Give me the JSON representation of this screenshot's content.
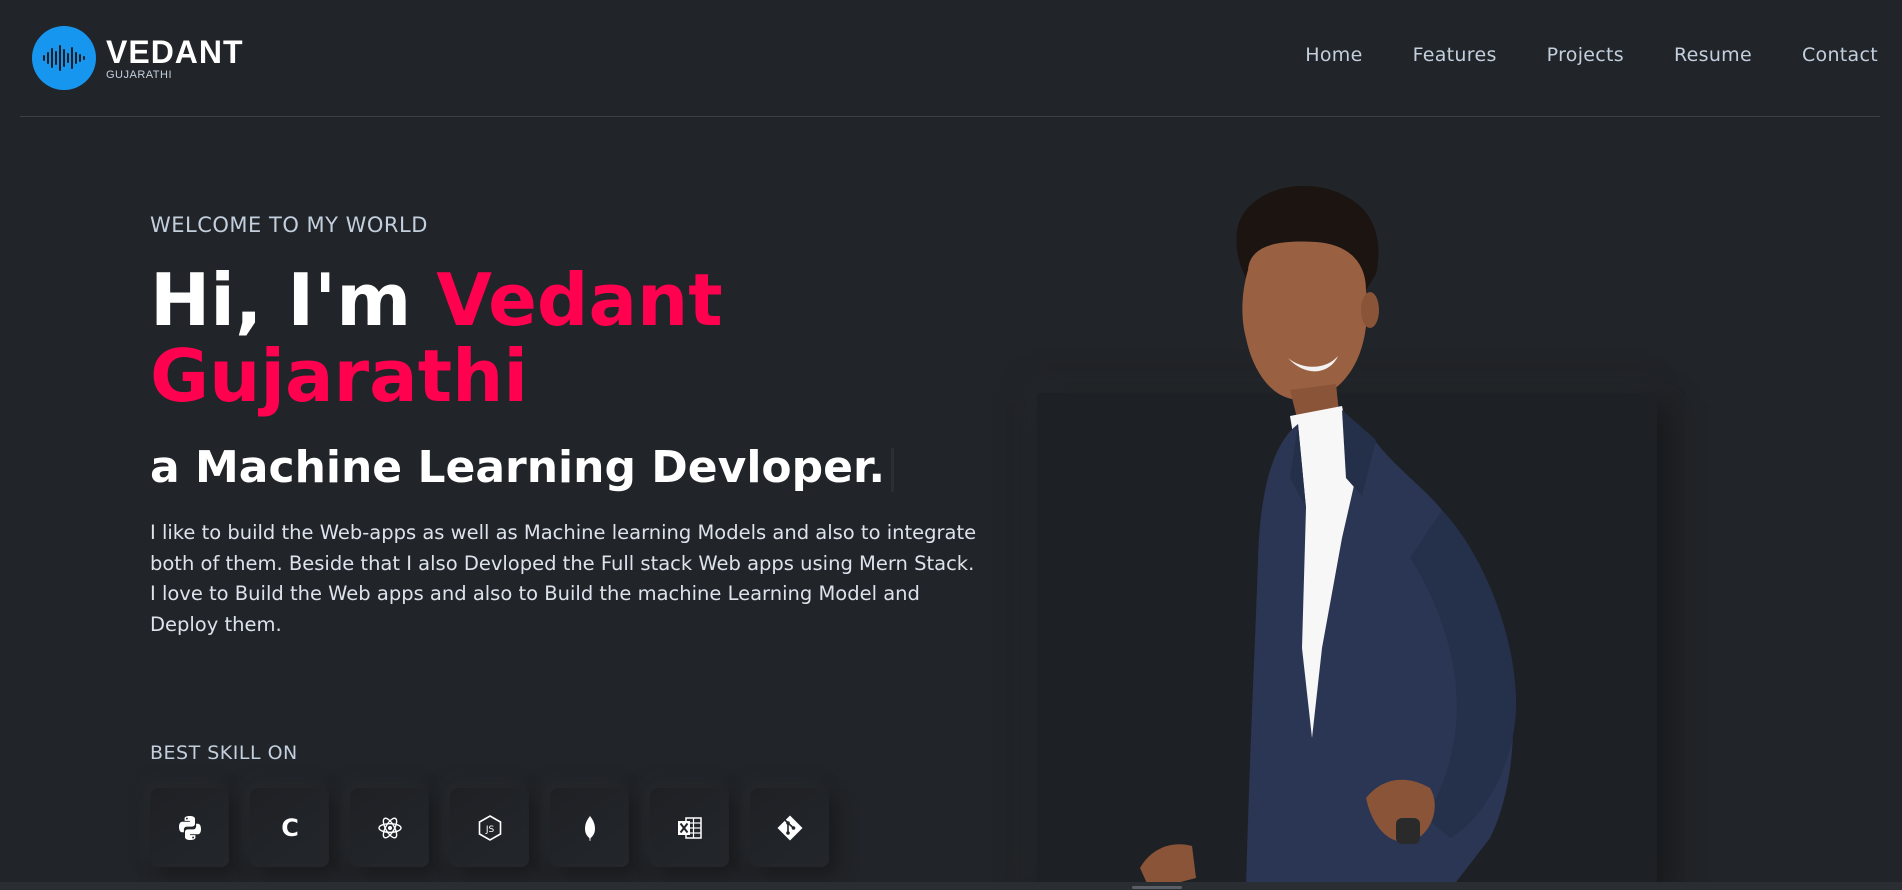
{
  "header": {
    "logo_name": "VEDANT",
    "logo_sub": "GUJARATHI",
    "nav": [
      {
        "label": "Home"
      },
      {
        "label": "Features"
      },
      {
        "label": "Projects"
      },
      {
        "label": "Resume"
      },
      {
        "label": "Contact"
      }
    ]
  },
  "hero": {
    "welcome": "WELCOME TO MY WORLD",
    "greeting": "Hi, I'm ",
    "name_first": "Vedant",
    "name_last": "Gujarathi",
    "role": "a Machine Learning Devloper.",
    "bio": "I like to build the Web-apps as well as Machine learning Models and also to integrate both of them. Beside that I also Devloped the Full stack Web apps using Mern Stack. I love to Build the Web apps and also to Build the machine Learning Model and Deploy them."
  },
  "skills": {
    "title": "BEST SKILL ON",
    "items": [
      {
        "icon": "python-icon"
      },
      {
        "icon": "c-language-icon",
        "glyph": "C"
      },
      {
        "icon": "react-icon"
      },
      {
        "icon": "nodejs-icon"
      },
      {
        "icon": "mongodb-icon"
      },
      {
        "icon": "excel-icon"
      },
      {
        "icon": "git-icon"
      }
    ]
  },
  "colors": {
    "background": "#212428",
    "accent": "#ff014f",
    "logo_blue": "#1796f0",
    "text": "#c4cfde"
  }
}
